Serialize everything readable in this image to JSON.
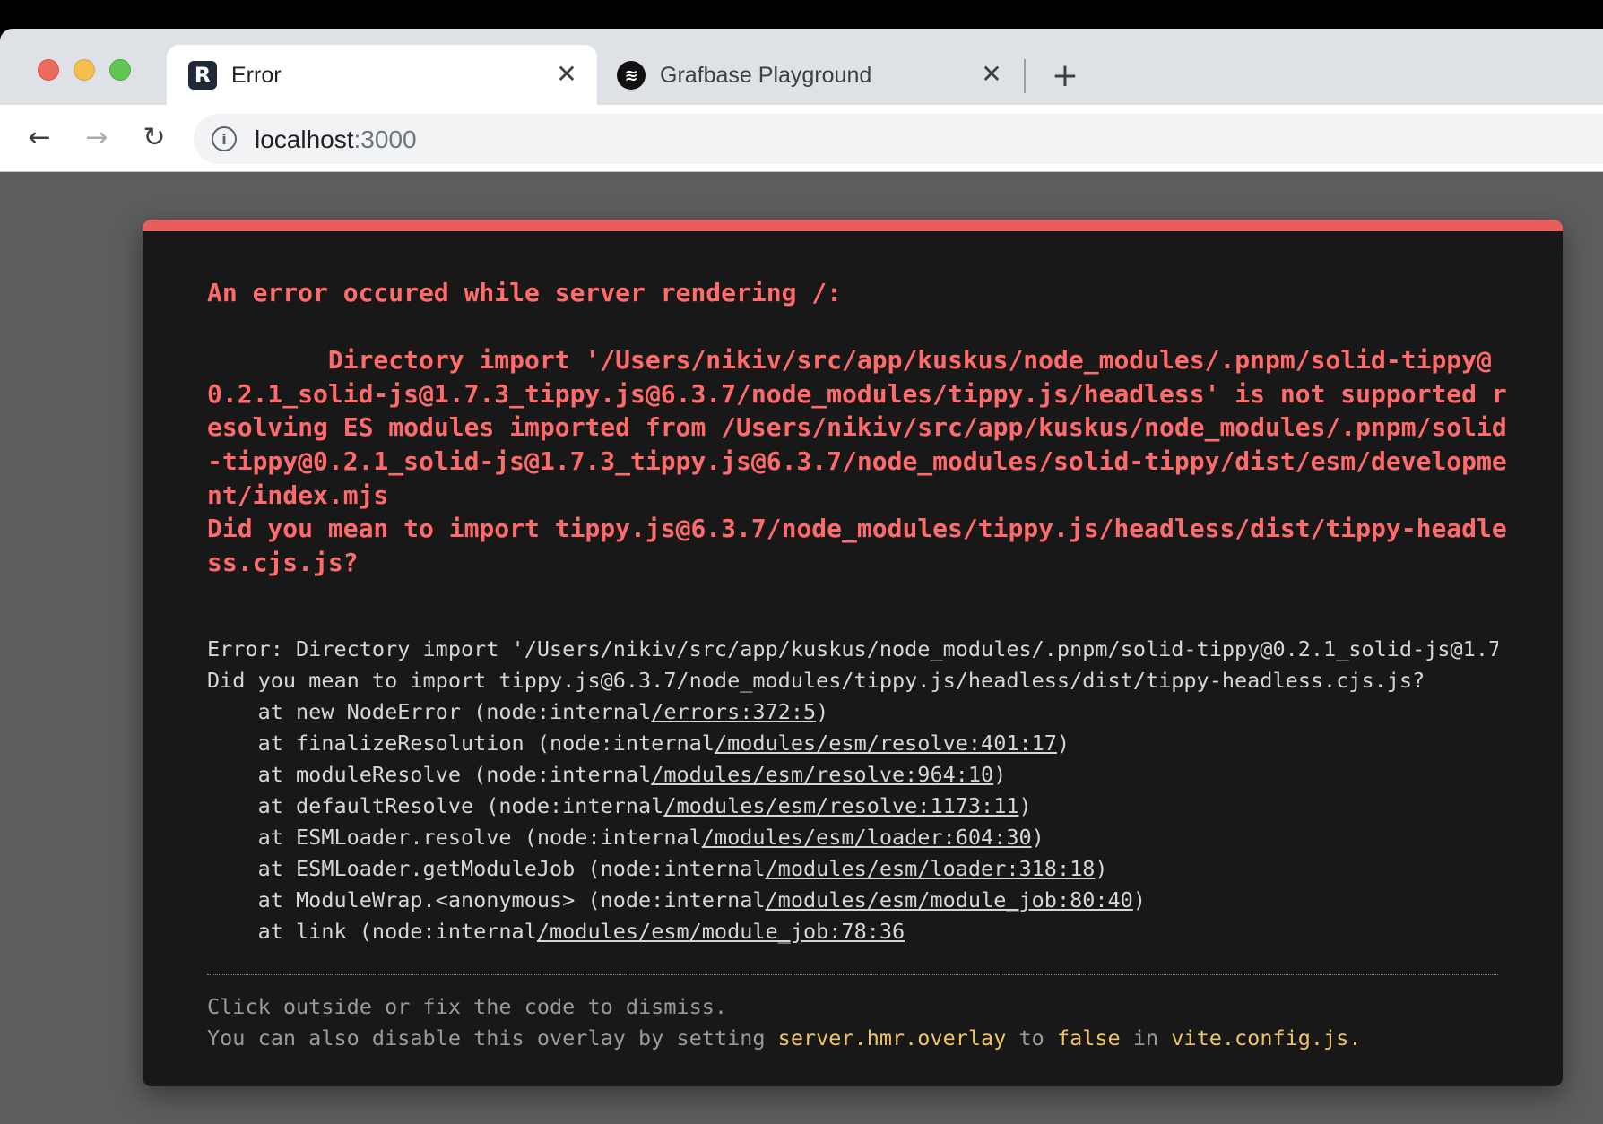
{
  "browser": {
    "tabs": [
      {
        "title": "Error",
        "favicon": "R",
        "active": true
      },
      {
        "title": "Grafbase Playground",
        "favicon": "≋",
        "active": false
      }
    ],
    "close_glyph": "✕",
    "new_tab_glyph": "+",
    "nav": {
      "back": "←",
      "forward": "→",
      "reload": "↻"
    },
    "url_host": "localhost",
    "url_port": ":3000",
    "info_glyph": "i"
  },
  "overlay": {
    "message": "An error occured while server rendering /:\n\n        Directory import '/Users/nikiv/src/app/kuskus/node_modules/.pnpm/solid-tippy@0.2.1_solid-js@1.7.3_tippy.js@6.3.7/node_modules/tippy.js/headless' is not supported resolving ES modules imported from /Users/nikiv/src/app/kuskus/node_modules/.pnpm/solid-tippy@0.2.1_solid-js@1.7.3_tippy.js@6.3.7/node_modules/solid-tippy/dist/esm/development/index.mjs\nDid you mean to import tippy.js@6.3.7/node_modules/tippy.js/headless/dist/tippy-headless.cjs.js?",
    "stack_head": [
      "Error: Directory import '/Users/nikiv/src/app/kuskus/node_modules/.pnpm/solid-tippy@0.2.1_solid-js@1.7",
      "Did you mean to import tippy.js@6.3.7/node_modules/tippy.js/headless/dist/tippy-headless.cjs.js?"
    ],
    "frames": [
      {
        "pre": "    at new NodeError (node:internal",
        "loc": "/errors:372:5",
        "post": ")"
      },
      {
        "pre": "    at finalizeResolution (node:internal",
        "loc": "/modules/esm/resolve:401:17",
        "post": ")"
      },
      {
        "pre": "    at moduleResolve (node:internal",
        "loc": "/modules/esm/resolve:964:10",
        "post": ")"
      },
      {
        "pre": "    at defaultResolve (node:internal",
        "loc": "/modules/esm/resolve:1173:11",
        "post": ")"
      },
      {
        "pre": "    at ESMLoader.resolve (node:internal",
        "loc": "/modules/esm/loader:604:30",
        "post": ")"
      },
      {
        "pre": "    at ESMLoader.getModuleJob (node:internal",
        "loc": "/modules/esm/loader:318:18",
        "post": ")"
      },
      {
        "pre": "    at ModuleWrap.<anonymous> (node:internal",
        "loc": "/modules/esm/module_job:80:40",
        "post": ")"
      },
      {
        "pre": "    at link (node:internal",
        "loc": "/modules/esm/module_job:78:36",
        "post": ""
      }
    ],
    "tip_line1": "Click outside or fix the code to dismiss.",
    "tip_line2_a": "You can also disable this overlay by setting ",
    "tip_code1": "server.hmr.overlay",
    "tip_line2_b": " to ",
    "tip_code2": "false",
    "tip_line2_c": " in ",
    "tip_code3": "vite.config.js."
  }
}
